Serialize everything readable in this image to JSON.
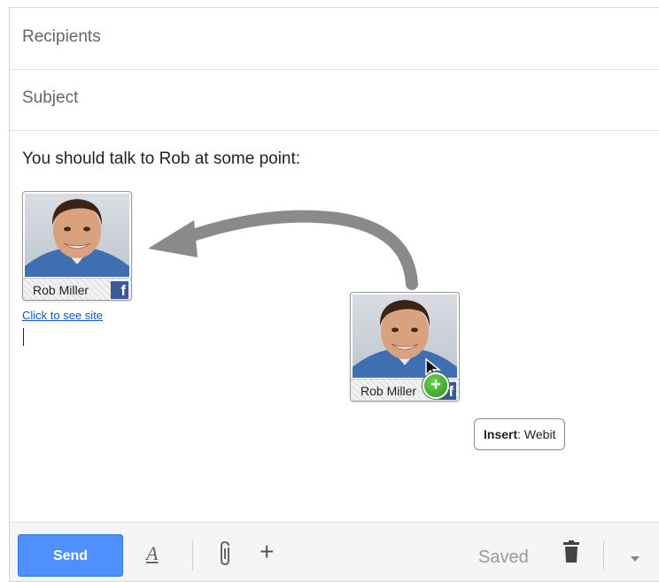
{
  "compose": {
    "recipients_placeholder": "Recipients",
    "subject_placeholder": "Subject",
    "body_text": "You should talk to Rob at some point:",
    "inserted_card": {
      "name": "Rob Miller",
      "link_text": "Click to see site"
    },
    "dragged_card": {
      "name": "Rob Miller"
    },
    "tooltip": {
      "action": "Insert",
      "target": ": Webit"
    }
  },
  "toolbar": {
    "send_label": "Send",
    "saved_label": "Saved"
  },
  "colors": {
    "send_blue": "#4d90fe",
    "facebook_blue": "#3b5998",
    "link_blue": "#1155cc",
    "arrow_gray": "#8a8a8a"
  }
}
